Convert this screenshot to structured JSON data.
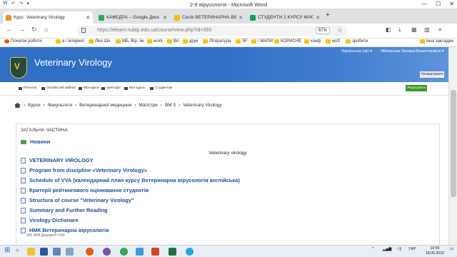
{
  "word": {
    "title": "2-9 вірусологія - Microsoft Word",
    "quick_access": [
      "W",
      "↶",
      "↷",
      "▾"
    ],
    "controls": [
      "—",
      "☐",
      "✕"
    ]
  },
  "tabs": [
    {
      "label": "Курс: Veterinary Virology",
      "color": "#f28c28",
      "active": true
    },
    {
      "label": "КАФЕДРА – Google Диск",
      "color": "#34a853",
      "active": false
    },
    {
      "label": "Сесія ВЕТЕРИНАРНА ВІРУСОЛ...",
      "color": "#fbbc05",
      "active": false
    },
    {
      "label": "СТУДЕНТИ 2 КУРСУ ФАКУЛЬ...",
      "color": "#0f9d58",
      "active": false
    }
  ],
  "new_tab": "+",
  "address": {
    "url": "https://elearn.nubip.edu.ua/course/view.php?id=393",
    "zoom": "67%"
  },
  "bookmarks": [
    {
      "label": "Початок роботи",
      "kind": "firefox"
    },
    {
      "label": "я / інтернет",
      "kind": "folder"
    },
    {
      "label": "Ліко Шк",
      "kind": "folder"
    },
    {
      "label": "МБ, Вір, Ім",
      "kind": "folder"
    },
    {
      "label": "work",
      "kind": "folder"
    },
    {
      "label": "ВА",
      "kind": "folder"
    },
    {
      "label": "друк",
      "kind": "folder"
    },
    {
      "label": "Література",
      "kind": "folder"
    },
    {
      "label": "SF",
      "kind": "folder"
    },
    {
      "label": "! МАПИ",
      "kind": "folder"
    },
    {
      "label": "КОРИСНЕ",
      "kind": "folder"
    },
    {
      "label": "конф",
      "kind": "folder"
    },
    {
      "label": "моб",
      "kind": "folder"
    },
    {
      "label": "зробити",
      "kind": "folder"
    },
    {
      "label": "Інші закладки",
      "kind": "folder"
    }
  ],
  "site": {
    "title": "Veterinary Virology",
    "language": "Українська (uk) ▾",
    "user": "Яблонська Оксана Валентинівна ▾",
    "customize": "Налаштувати"
  },
  "nav": {
    "items": [
      "Початок",
      "Особистий кабінет",
      "Мої курси",
      "Цей курс",
      "Мої курси",
      "Студентам"
    ],
    "edit": "Редагувати"
  },
  "breadcrumb": [
    "Курси",
    "Факультети",
    "Ветеринарної медицини",
    "Магістри",
    "ВМ 5",
    "Veterinary Virology"
  ],
  "section": {
    "title": "ЗАГАЛЬНА ЧАСТИНА",
    "forum": "Новини",
    "heading": "Veterinary virology",
    "items": [
      "VETERINARY VIROLOGY",
      "Program from discipline «Veterinary Virology»",
      "Schedule of VVA (календарний план курсу Ветеринарна вірусологія англійська)",
      "Критерії рейтингового оцінювання студентів",
      "Structura of course \"Veterinary Virology\"",
      "Summary and Further Reading",
      "Virology Dictionare",
      "НМК Ветеринарна вірусологія"
    ],
    "last_meta": "393.9KB Документ PDF"
  },
  "taskbar": {
    "apps": [
      {
        "name": "file-explorer",
        "color": "#f3c234"
      },
      {
        "name": "word",
        "color": "#2b579a"
      },
      {
        "name": "firefox",
        "color": "#e66000"
      },
      {
        "name": "viber",
        "color": "#7b519d"
      },
      {
        "name": "chrome",
        "color": "#34a853"
      },
      {
        "name": "paint",
        "color": "#3a9ad9"
      },
      {
        "name": "powerpoint",
        "color": "#d24726"
      },
      {
        "name": "excel",
        "color": "#1f7244"
      },
      {
        "name": "telegram",
        "color": "#2aa3df"
      }
    ],
    "lang": "УКР",
    "time": "10:56",
    "date": "18.05.2022"
  },
  "colors": {
    "header_blue": "#2f6fc4",
    "link": "#1f4f9d",
    "edit_green": "#3c9a2a"
  }
}
